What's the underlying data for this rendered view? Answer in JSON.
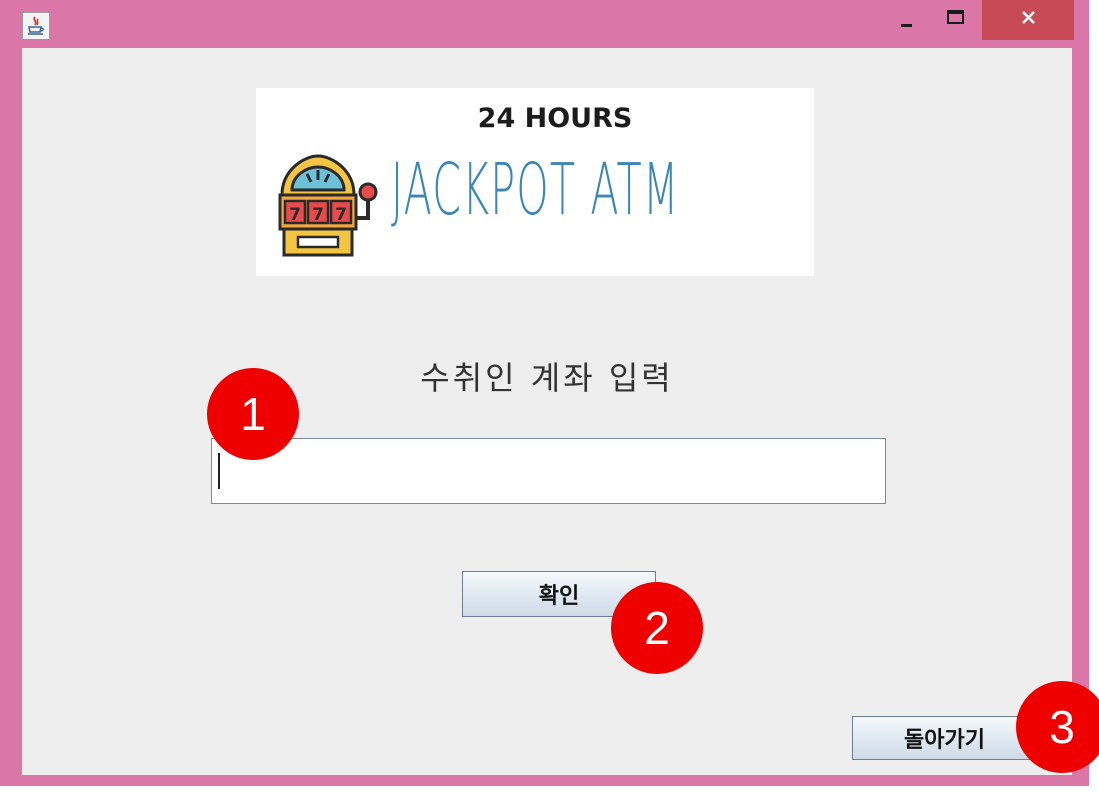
{
  "window": {
    "controls": {
      "minimize_icon": "minimize-icon",
      "maximize_icon": "maximize-icon",
      "close_icon": "close-icon"
    },
    "frame_color": "#db77a8",
    "close_color": "#c74a56"
  },
  "logo": {
    "line1": "24 HOURS",
    "line2": "JACKPOT ATM",
    "icon": "slot-machine-icon",
    "accent": "#3a86b4"
  },
  "form": {
    "prompt": "수취인 계좌 입력",
    "account_value": "",
    "confirm_label": "확인",
    "back_label": "돌아가기"
  },
  "markers": [
    "1",
    "2",
    "3"
  ],
  "marker_color": "#ee0000"
}
